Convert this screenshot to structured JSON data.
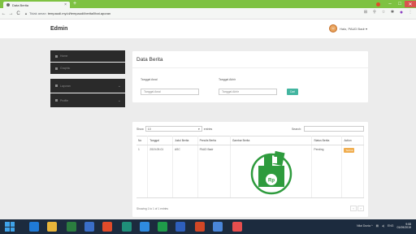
{
  "browser": {
    "tab_title": "Data Berita",
    "tab_close": "×",
    "new_tab": "+",
    "nav_back": "←",
    "nav_forward": "→",
    "nav_reload": "C",
    "security": "Tidak aman",
    "url": "tempaudi.my.id/tempaudi/berita/lihat.aporan",
    "window_min": "–",
    "window_max": "□",
    "window_close": "✕"
  },
  "app": {
    "brand": "Edmin",
    "user_name": "Halo, PAUD Badr ▾"
  },
  "sidebar": {
    "items": [
      {
        "label": "Home",
        "icon": "home-icon"
      },
      {
        "label": "Graphic",
        "icon": "chart-icon"
      },
      {
        "label": "Laporan",
        "icon": "report-icon",
        "expandable": true
      },
      {
        "label": "Profile",
        "icon": "user-icon",
        "expandable": true
      }
    ]
  },
  "filter": {
    "title": "Data Berita",
    "tanggal_awal_label": "Tanggal Awal",
    "tanggal_awal_placeholder": "Tanggal Awal",
    "tanggal_akhir_label": "Tanggal Akhir",
    "tanggal_akhir_placeholder": "Tanggal Akhir",
    "cari_button": "Cari"
  },
  "table": {
    "show_label": "Show",
    "show_value": "10",
    "entries_label": "entries",
    "search_label": "Search:",
    "columns": [
      "No",
      "Tanggal",
      "Judul Berita",
      "Penulis Berita",
      "Gambar Berita",
      "Status Berita",
      "Action"
    ],
    "rows": [
      {
        "no": "1",
        "tanggal": "2019-09-01",
        "judul": "ASC",
        "penulis": "PAUD Badr",
        "gambar": "money-rp-icon",
        "status": "Pending",
        "action": "Terima"
      }
    ],
    "info": "Showing 1 to 1 of 1 entries",
    "prev": "‹",
    "next": "›"
  },
  "taskbar": {
    "lang": "ENG",
    "time": "9:08",
    "date": "01/09/2019",
    "status_text": "Nilai Dunia ^"
  },
  "colors": {
    "chrome_green": "#7ec242",
    "sidebar_dark": "#2a2a2a",
    "cari_teal": "#43b5a0",
    "badge_orange": "#f0ad4e",
    "money_green": "#2e9b3d",
    "taskbar": "#1c2b3e"
  }
}
